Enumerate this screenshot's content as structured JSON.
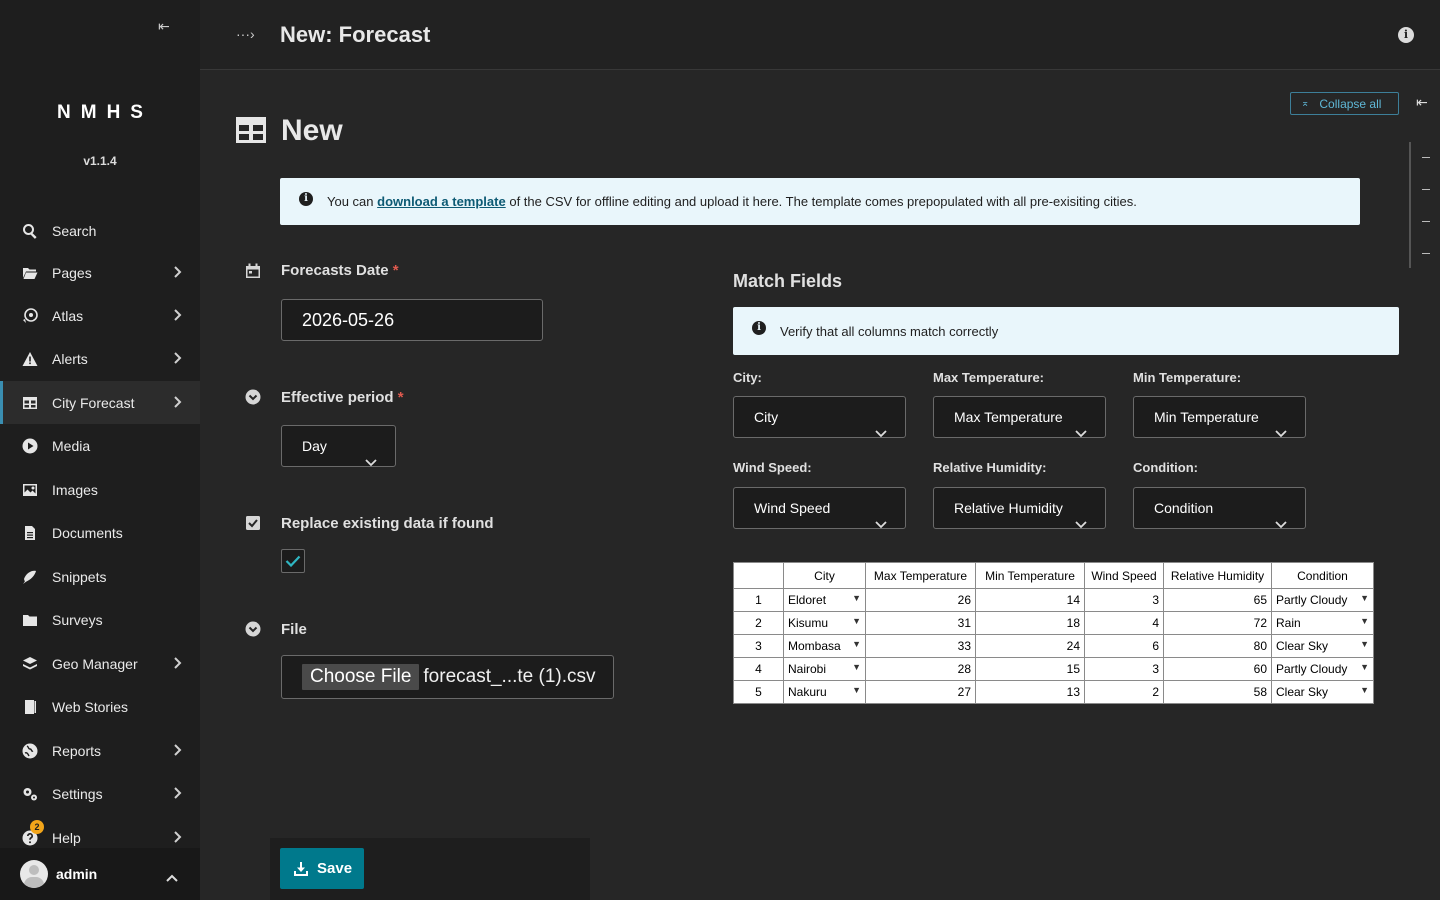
{
  "sidebar": {
    "brand": "NMHS",
    "version": "v1.1.4",
    "items": [
      {
        "label": "Search",
        "icon": "search-icon"
      },
      {
        "label": "Pages",
        "icon": "folder-open-icon"
      },
      {
        "label": "Atlas",
        "icon": "globe-pin-icon"
      },
      {
        "label": "Alerts",
        "icon": "warning-icon"
      },
      {
        "label": "City Forecast",
        "icon": "table-icon"
      },
      {
        "label": "Media",
        "icon": "play-icon"
      },
      {
        "label": "Images",
        "icon": "image-icon"
      },
      {
        "label": "Documents",
        "icon": "document-icon"
      },
      {
        "label": "Snippets",
        "icon": "snippet-icon"
      },
      {
        "label": "Surveys",
        "icon": "folder-icon"
      },
      {
        "label": "Geo Manager",
        "icon": "layers-icon"
      },
      {
        "label": "Web Stories",
        "icon": "book-icon"
      },
      {
        "label": "Reports",
        "icon": "globe-icon"
      },
      {
        "label": "Settings",
        "icon": "cogs-icon"
      },
      {
        "label": "Help",
        "icon": "help-icon"
      }
    ],
    "help_badge": "2",
    "account_name": "admin"
  },
  "header": {
    "title": "New: Forecast"
  },
  "toolbar": {
    "collapse_all_label": "Collapse all"
  },
  "page": {
    "title": "New"
  },
  "help_banner": {
    "prefix": "You can",
    "link": "download a template",
    "suffix": "of the CSV for offline editing and upload it here. The template comes prepopulated with all pre-exisiting cities."
  },
  "form": {
    "forecast_date_label": "Forecasts Date",
    "forecast_date_value": "2026-05-26",
    "effective_period_label": "Effective period",
    "effective_period_value": "Day",
    "replace_label": "Replace existing data if found",
    "file_label": "File",
    "file_button": "Choose File",
    "file_name": "forecast_...te (1).csv",
    "required_mark": "*",
    "save_label": "Save"
  },
  "match_fields": {
    "title": "Match Fields",
    "verify_text": "Verify that all columns match correctly",
    "fields": [
      {
        "label": "City:",
        "value": "City"
      },
      {
        "label": "Max Temperature:",
        "value": "Max Temperature"
      },
      {
        "label": "Min Temperature:",
        "value": "Min Temperature"
      },
      {
        "label": "Wind Speed:",
        "value": "Wind Speed"
      },
      {
        "label": "Relative Humidity:",
        "value": "Relative Humidity"
      },
      {
        "label": "Condition:",
        "value": "Condition"
      }
    ]
  },
  "preview_table": {
    "headers": [
      "",
      "City",
      "Max Temperature",
      "Min Temperature",
      "Wind Speed",
      "Relative Humidity",
      "Condition"
    ],
    "rows": [
      [
        "1",
        "Eldoret",
        "26",
        "14",
        "3",
        "65",
        "Partly Cloudy"
      ],
      [
        "2",
        "Kisumu",
        "31",
        "18",
        "4",
        "72",
        "Rain"
      ],
      [
        "3",
        "Mombasa",
        "33",
        "24",
        "6",
        "80",
        "Clear Sky"
      ],
      [
        "4",
        "Nairobi",
        "28",
        "15",
        "3",
        "60",
        "Partly Cloudy"
      ],
      [
        "5",
        "Nakuru",
        "27",
        "13",
        "2",
        "58",
        "Clear Sky"
      ]
    ]
  }
}
